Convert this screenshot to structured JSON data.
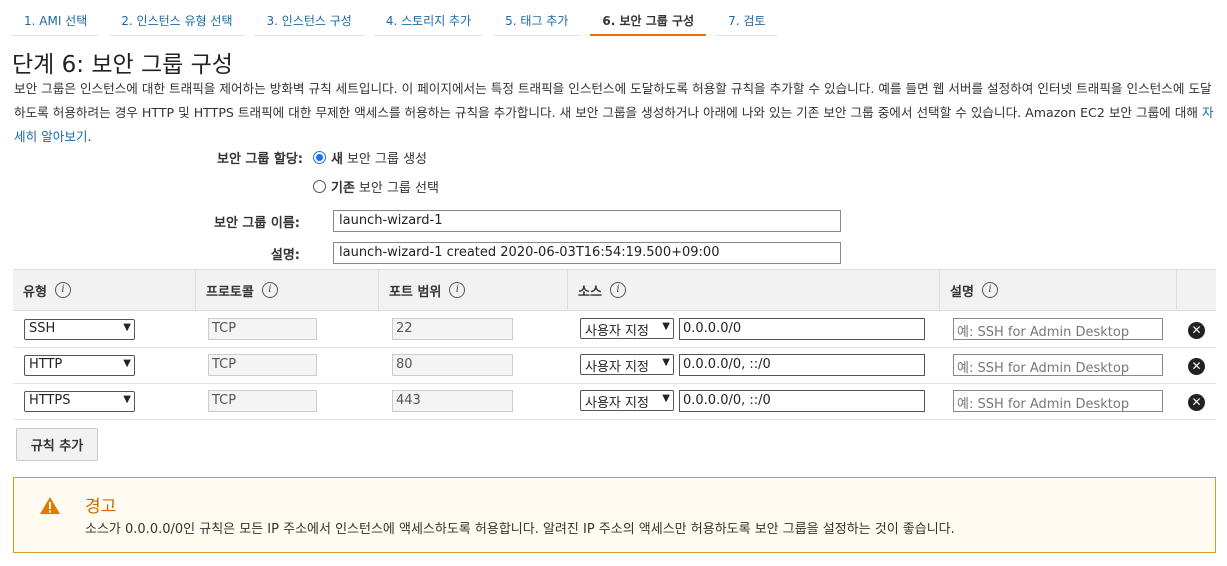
{
  "steps": [
    {
      "label": "1. AMI 선택"
    },
    {
      "label": "2. 인스턴스 유형 선택"
    },
    {
      "label": "3. 인스턴스 구성"
    },
    {
      "label": "4. 스토리지 추가"
    },
    {
      "label": "5. 태그 추가"
    },
    {
      "label": "6. 보안 그룹 구성"
    },
    {
      "label": "7. 검토"
    }
  ],
  "page": {
    "title": "단계 6: 보안 그룹 구성",
    "intro": "보안 그룹은 인스턴스에 대한 트래픽을 제어하는 방화벽 규칙 세트입니다. 이 페이지에서는 특정 트래픽을 인스턴스에 도달하도록 허용할 규칙을 추가할 수 있습니다. 예를 들면 웹 서버를 설정하여 인터넷 트래픽을 인스턴스에 도달하도록 허용하려는 경우 HTTP 및 HTTPS 트래픽에 대한 무제한 액세스를 허용하는 규칙을 추가합니다. 새 보안 그룹을 생성하거나 아래에 나와 있는 기존 보안 그룹 중에서 선택할 수 있습니다. Amazon EC2 보안 그룹에 대해 ",
    "learn_more": "자세히 알아보기",
    "intro_end": "."
  },
  "form": {
    "assign_label": "보안 그룹 할당:",
    "option_new_bold": "새",
    "option_new_rest": "보안 그룹 생성",
    "option_existing_bold": "기존",
    "option_existing_rest": "보안 그룹 선택",
    "name_label": "보안 그룹 이름:",
    "name_value": "launch-wizard-1",
    "desc_label": "설명:",
    "desc_value": "launch-wizard-1 created 2020-06-03T16:54:19.500+09:00"
  },
  "table": {
    "headers": {
      "type": "유형",
      "protocol": "프로토콜",
      "port": "포트 범위",
      "source": "소스",
      "desc": "설명"
    },
    "rows": [
      {
        "type": "SSH",
        "protocol": "TCP",
        "port": "22",
        "source_mode": "사용자 지정",
        "source": "0.0.0.0/0",
        "desc_placeholder": "예: SSH for Admin Desktop"
      },
      {
        "type": "HTTP",
        "protocol": "TCP",
        "port": "80",
        "source_mode": "사용자 지정",
        "source": "0.0.0.0/0, ::/0",
        "desc_placeholder": "예: SSH for Admin Desktop"
      },
      {
        "type": "HTTPS",
        "protocol": "TCP",
        "port": "443",
        "source_mode": "사용자 지정",
        "source": "0.0.0.0/0, ::/0",
        "desc_placeholder": "예: SSH for Admin Desktop"
      }
    ],
    "add_rule": "규칙 추가"
  },
  "warning": {
    "title": "경고",
    "text": "소스가 0.0.0.0/0인 규칙은 모든 IP 주소에서 인스턴스에 액세스하도록 허용합니다. 알려진 IP 주소의 액세스만 허용하도록 보안 그룹을 설정하는 것이 좋습니다."
  },
  "colors": {
    "accent": "#ec7211",
    "link": "#1b6aa5",
    "warning_border": "#d89a25",
    "warning_title": "#c96a00"
  }
}
